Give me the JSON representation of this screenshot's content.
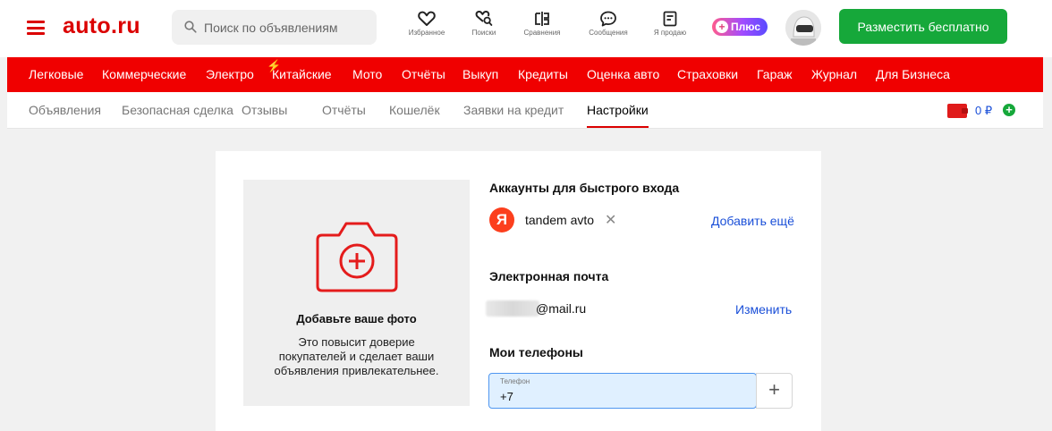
{
  "header": {
    "logo": "auto.ru",
    "search_placeholder": "Поиск по объявлениям",
    "icons": [
      {
        "name": "favorites-icon",
        "label": "Избранное"
      },
      {
        "name": "saved-searches-icon",
        "label": "Поиски"
      },
      {
        "name": "compare-icon",
        "label": "Сравнения"
      },
      {
        "name": "messages-icon",
        "label": "Сообщения"
      },
      {
        "name": "sell-icon",
        "label": "Я продаю"
      }
    ],
    "plus_label": "Плюс",
    "plus_glyph": "+",
    "place_button": "Разместить бесплатно"
  },
  "categories": [
    "Легковые",
    "Коммерческие",
    "Электро",
    "Китайские",
    "Мото",
    "Отчёты",
    "Выкуп",
    "Кредиты",
    "Оценка авто",
    "Страховки",
    "Гараж",
    "Журнал",
    "Для Бизнеса"
  ],
  "tabs": {
    "items": [
      "Объявления",
      "Безопасная сделка",
      "Отзывы",
      "Отчёты",
      "Кошелёк",
      "Заявки на кредит",
      "Настройки"
    ],
    "active": "Настройки",
    "balance": "0 ₽",
    "add_glyph": "+"
  },
  "photo": {
    "title": "Добавьте ваше фото",
    "description": "Это повысит доверие покупателей и сделает ваши объявления привлекательнее."
  },
  "accounts": {
    "title": "Аккаунты для быстрого входа",
    "provider_letter": "Я",
    "account_name": "tandem avto",
    "remove_glyph": "✕",
    "add_more": "Добавить ещё"
  },
  "email": {
    "title": "Электронная почта",
    "domain": "@mail.ru",
    "change": "Изменить"
  },
  "phones": {
    "title": "Мои телефоны",
    "field_label": "Телефон",
    "field_value": "+7",
    "add_glyph": "+"
  },
  "colors": {
    "brand_red": "#f00000",
    "accent_green": "#16a83a",
    "link_blue": "#1a4fd8"
  }
}
